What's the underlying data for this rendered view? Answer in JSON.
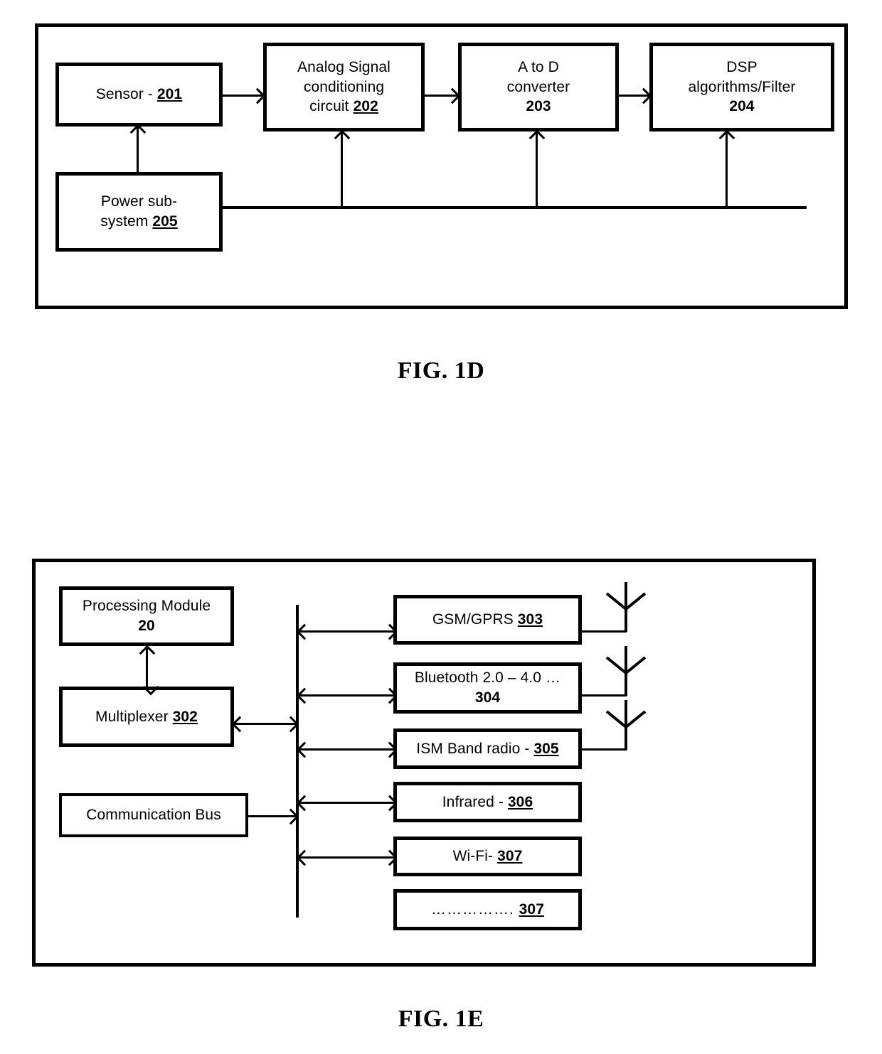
{
  "document": {
    "type": "patent-figure-sheet",
    "figures": [
      {
        "caption": "FIG. 1D",
        "id": "fig-1d",
        "blocks": [
          {
            "id": "sensor",
            "label": "Sensor  - ",
            "ref": "201",
            "ref_style": "underline"
          },
          {
            "id": "analog",
            "label_line1": "Analog Signal",
            "label_line2": "conditioning",
            "label_line3": "circuit ",
            "ref": "202",
            "ref_style": "underline"
          },
          {
            "id": "adc",
            "label_line1": "A to D",
            "label_line2": "converter",
            "ref": "203",
            "ref_style": "bold"
          },
          {
            "id": "dsp",
            "label_line1": "DSP",
            "label_line2": "algorithms/Filter",
            "ref": "204",
            "ref_style": "bold"
          },
          {
            "id": "power",
            "label_line1": "Power sub-",
            "label_line2": "system ",
            "ref": "205",
            "ref_style": "underline"
          }
        ]
      },
      {
        "caption": "FIG. 1E",
        "id": "fig-1e",
        "left_blocks": [
          {
            "id": "processing-module",
            "label": "Processing Module",
            "ref": "20",
            "ref_style": "bold"
          },
          {
            "id": "multiplexer",
            "label": "Multiplexer ",
            "ref": "302",
            "ref_style": "underline"
          },
          {
            "id": "communication-bus",
            "label": "Communication Bus",
            "ref": "",
            "ref_style": "none"
          }
        ],
        "right_blocks": [
          {
            "id": "gsm-gprs",
            "label": "GSM/GPRS ",
            "ref": "303",
            "ref_style": "underline",
            "antenna": true
          },
          {
            "id": "bluetooth",
            "label": "Bluetooth 2.0 – 4.0 …",
            "ref": "304",
            "ref_style": "bold",
            "antenna": true,
            "two_line": true
          },
          {
            "id": "ism-band",
            "label": "ISM Band radio - ",
            "ref": "305",
            "ref_style": "underline",
            "antenna": true
          },
          {
            "id": "infrared",
            "label": "Infrared - ",
            "ref": "306",
            "ref_style": "underline",
            "antenna": false
          },
          {
            "id": "wifi",
            "label": "Wi-Fi- ",
            "ref": "307",
            "ref_style": "underline",
            "antenna": false
          },
          {
            "id": "other",
            "label": "……………. ",
            "ref": "307",
            "ref_style": "underline",
            "antenna": false
          }
        ]
      }
    ]
  },
  "fig1d": {
    "sensor": {
      "text": "Sensor  - ",
      "ref": "201"
    },
    "analog": {
      "l1": "Analog Signal",
      "l2": "conditioning",
      "l3": "circuit ",
      "ref": "202"
    },
    "adc": {
      "l1": "A to D",
      "l2": "converter",
      "ref": "203"
    },
    "dsp": {
      "l1": "DSP",
      "l2": "algorithms/Filter",
      "ref": "204"
    },
    "power": {
      "l1": "Power sub-",
      "l2": "system ",
      "ref": "205"
    },
    "caption": "FIG. 1D"
  },
  "fig1e": {
    "processing": {
      "l1": "Processing Module",
      "ref": "20"
    },
    "multiplexer": {
      "text": "Multiplexer ",
      "ref": "302"
    },
    "commbus": {
      "text": "Communication Bus"
    },
    "gsm": {
      "text": "GSM/GPRS ",
      "ref": "303"
    },
    "bt": {
      "l1": "Bluetooth 2.0 – 4.0 …",
      "ref": "304"
    },
    "ism": {
      "text": "ISM Band radio - ",
      "ref": "305"
    },
    "ir": {
      "text": "Infrared - ",
      "ref": "306"
    },
    "wifi": {
      "text": "Wi-Fi- ",
      "ref": "307"
    },
    "other": {
      "text": "……………. ",
      "ref": "307"
    },
    "caption": "FIG. 1E"
  },
  "colors": {
    "stroke": "#000000",
    "background": "#ffffff"
  }
}
